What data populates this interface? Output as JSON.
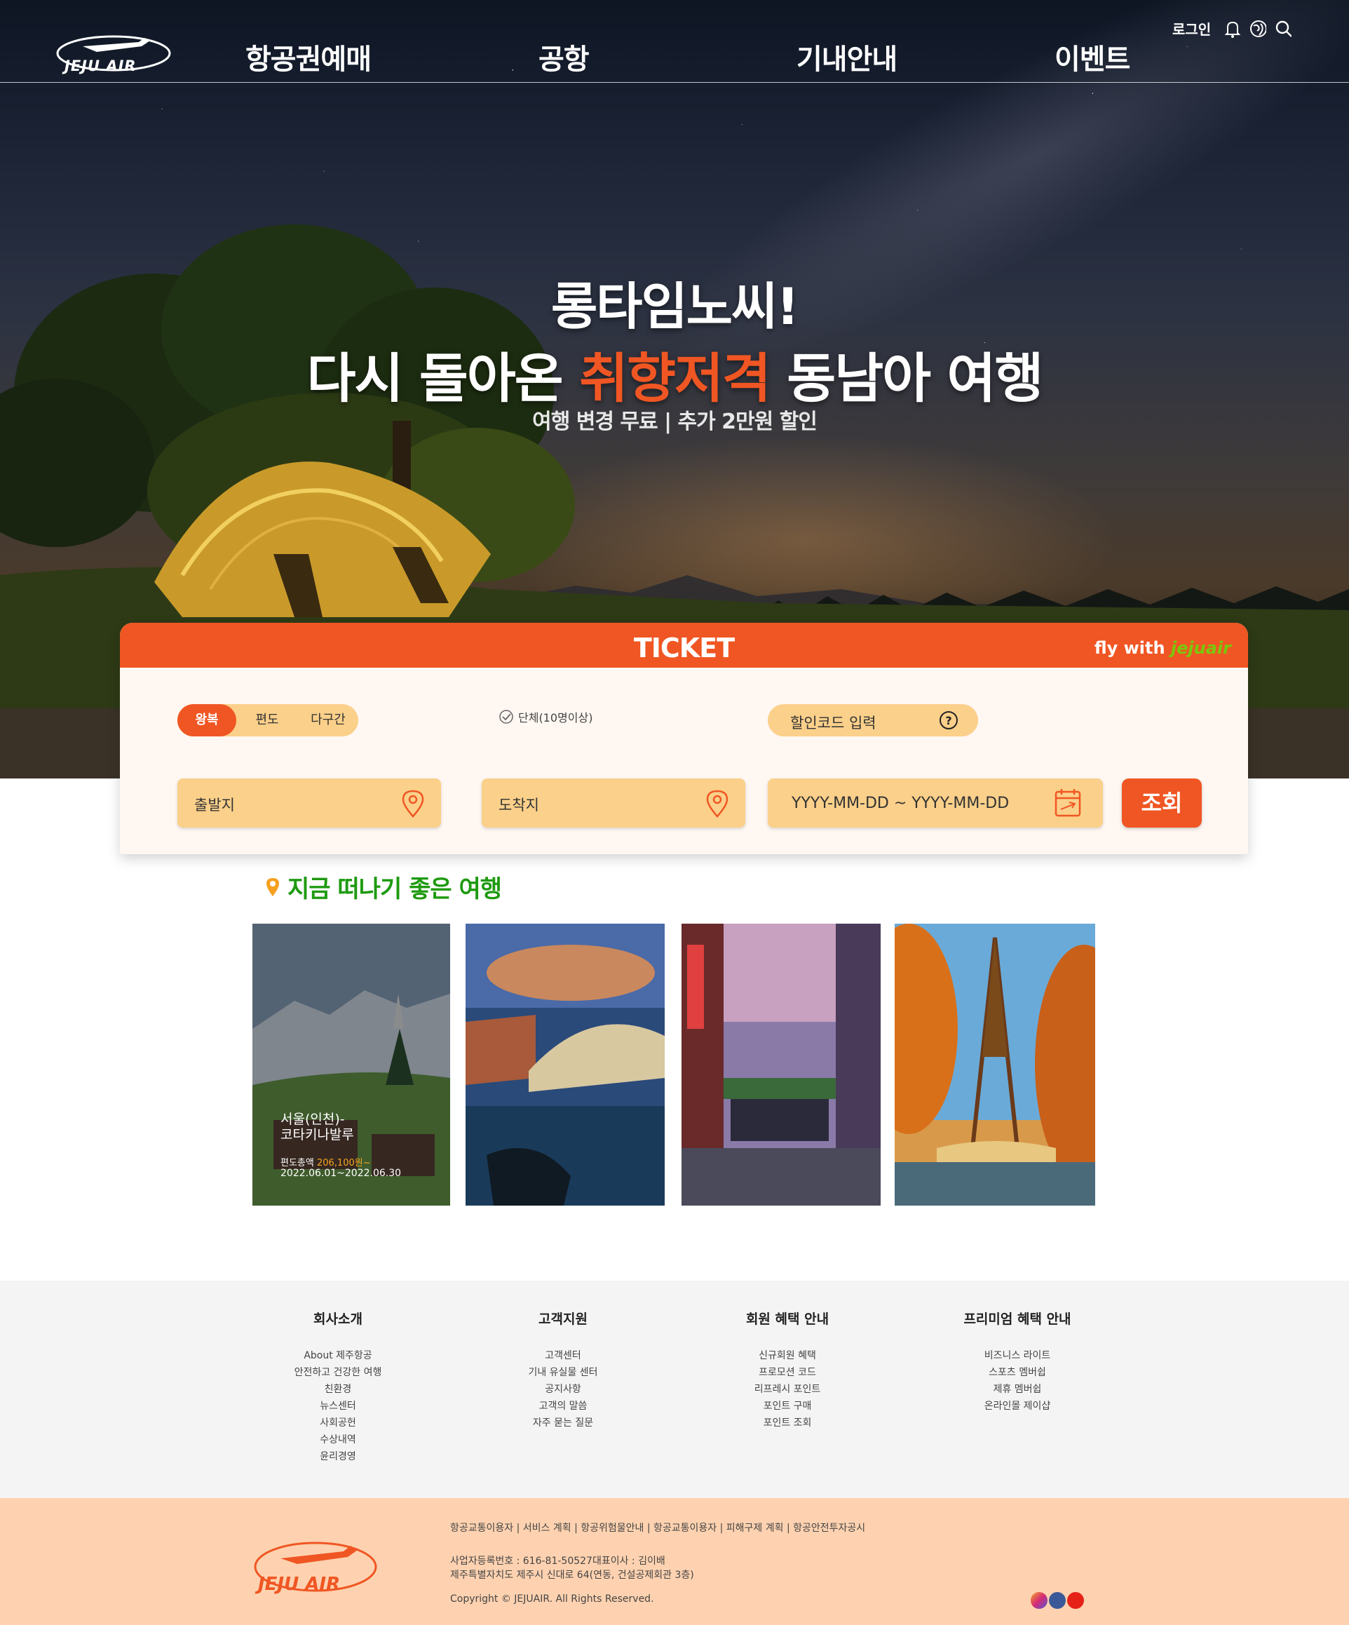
{
  "header": {
    "logo_text": "JEJU AIR",
    "nav": [
      "항공권예매",
      "공항",
      "기내안내",
      "이벤트"
    ],
    "login": "로그인",
    "icons": [
      "bell-icon",
      "globe-icon",
      "search-icon"
    ]
  },
  "hero": {
    "line1": "롱타임노씨!",
    "line2_pre": "다시 돌아온 ",
    "line2_highlight": "취향저격",
    "line2_post": " 동남아 여행",
    "subline": "여행 변경 무료 | 추가 2만원 할인"
  },
  "ticket": {
    "title": "TICKET",
    "tagline_pre": "fly with",
    "tagline_brand": "jejuair",
    "trip_types": [
      "왕복",
      "편도",
      "다구간"
    ],
    "trip_active": "왕복",
    "group_label": "단체(10명이상)",
    "discount_label": "할인코드 입력",
    "departure_placeholder": "출발지",
    "arrival_placeholder": "도착지",
    "date_placeholder": "YYYY-MM-DD ~ YYYY-MM-DD",
    "search_button": "조회"
  },
  "recommend": {
    "title": "지금 떠나기 좋은 여행",
    "cards": [
      {
        "route": "서울(인천)-\n코타키나발루",
        "fare_label": "편도총액",
        "fare_amount": "206,100원~",
        "period": "2022.06.01~2022.06.30"
      },
      {
        "route": "",
        "fare_label": "",
        "fare_amount": "",
        "period": ""
      },
      {
        "route": "",
        "fare_label": "",
        "fare_amount": "",
        "period": ""
      },
      {
        "route": "",
        "fare_label": "",
        "fare_amount": "",
        "period": ""
      }
    ]
  },
  "footer_links": [
    {
      "heading": "회사소개",
      "items": [
        "About 제주항공",
        "안전하고 건강한 여행",
        "친환경",
        "뉴스센터",
        "사회공헌",
        "수상내역",
        "윤리경영"
      ]
    },
    {
      "heading": "고객지원",
      "items": [
        "고객센터",
        "기내 유실물 센터",
        "공지사항",
        "고객의 말씀",
        "자주 묻는 질문"
      ]
    },
    {
      "heading": "회원 혜택 안내",
      "items": [
        "신규회원 혜택",
        "프로모션 코드",
        "리프레시 포인트",
        "포인트 구매",
        "포인트 조회"
      ]
    },
    {
      "heading": "프리미엄 혜택 안내",
      "items": [
        "비즈니스 라이트",
        "스포츠 멤버쉽",
        "제휴 멤버쉽",
        "온라인몰 제이샵"
      ]
    }
  ],
  "footer": {
    "logo_text": "JEJU AIR",
    "links": "항공교통이용자 | 서비스 계획 | 항공위험물안내 | 항공교통이용자 | 피해구제 계획 | 항공안전투자공시",
    "biz_line1": "사업자등록번호 : 616-81-50527대표이사 : 김이배",
    "biz_line2": "제주특별자치도 제주시 신대로 64(연동, 건설공제회관 3층)",
    "copyright": "Copyright © JEJUAIR. All Rights Reserved.",
    "social": [
      "instagram-icon",
      "facebook-icon",
      "youtube-icon"
    ]
  },
  "colors": {
    "brand_orange": "#f05623",
    "field_yellow": "#fbd08a",
    "green": "#1e9a10",
    "footer_peach": "#fed2b0"
  }
}
